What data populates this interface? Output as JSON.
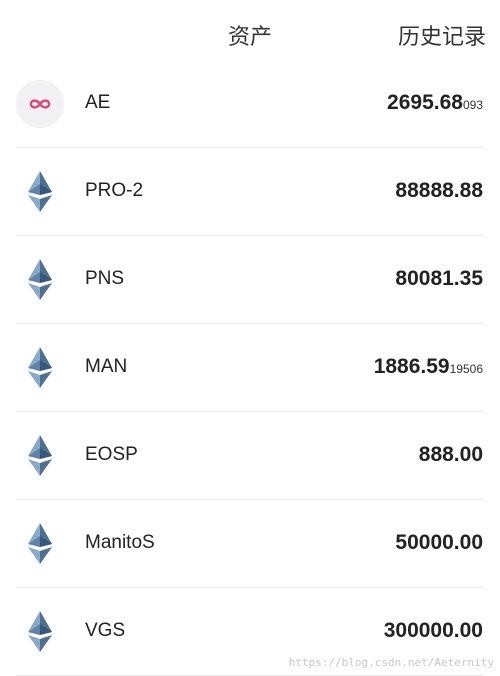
{
  "header": {
    "title": "资产",
    "history_label": "历史记录"
  },
  "assets": [
    {
      "name": "AE",
      "amount": "2695.68",
      "amount_fraction": "093",
      "icon": "aeternity-infinity-icon"
    },
    {
      "name": "PRO-2",
      "amount": "88888.88",
      "amount_fraction": "",
      "icon": "ethereum-diamond-icon"
    },
    {
      "name": "PNS",
      "amount": "80081.35",
      "amount_fraction": "",
      "icon": "ethereum-diamond-icon"
    },
    {
      "name": "MAN",
      "amount": "1886.59",
      "amount_fraction": "19506",
      "icon": "ethereum-diamond-icon"
    },
    {
      "name": "EOSP",
      "amount": "888.00",
      "amount_fraction": "",
      "icon": "ethereum-diamond-icon"
    },
    {
      "name": "ManitoS",
      "amount": "50000.00",
      "amount_fraction": "",
      "icon": "ethereum-diamond-icon"
    },
    {
      "name": "VGS",
      "amount": "300000.00",
      "amount_fraction": "",
      "icon": "ethereum-diamond-icon"
    }
  ],
  "watermark": "https://blog.csdn.net/Aeternity",
  "colors": {
    "ae_icon": "#e0457b",
    "eth_dark": "#4d6f92",
    "eth_light": "#8aa9c8",
    "divider": "#e8e8e8"
  }
}
